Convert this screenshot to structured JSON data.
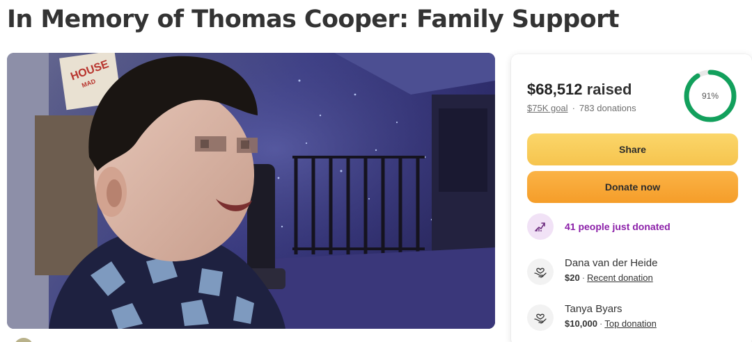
{
  "page": {
    "title": "In Memory of Thomas Cooper: Family Support"
  },
  "hero": {
    "sign_text": "HOUSE",
    "sign_subtext": "MAD"
  },
  "card": {
    "raised_amount": "$68,512",
    "raised_word": "raised",
    "goal": "$75K goal",
    "separator": "·",
    "donation_count": "783 donations",
    "progress_percent": 91,
    "progress_label": "91%",
    "share_label": "Share",
    "donate_label": "Donate now",
    "recent_activity": "41 people just donated",
    "donors": [
      {
        "name": "Dana van der Heide",
        "amount": "$20",
        "tag": "Recent donation"
      },
      {
        "name": "Tanya Byars",
        "amount": "$10,000",
        "tag": "Top donation"
      }
    ]
  },
  "colors": {
    "progress_ring": "#12a05c",
    "progress_track": "#e8e8e8",
    "share_button": "#f6c44e",
    "donate_button": "#f59d29",
    "recent_activity_text": "#8b1fa8",
    "trend_badge_bg": "#f1e2f6"
  },
  "icons": {
    "trend": "trending-up-icon",
    "donor": "heart-hands-icon"
  }
}
